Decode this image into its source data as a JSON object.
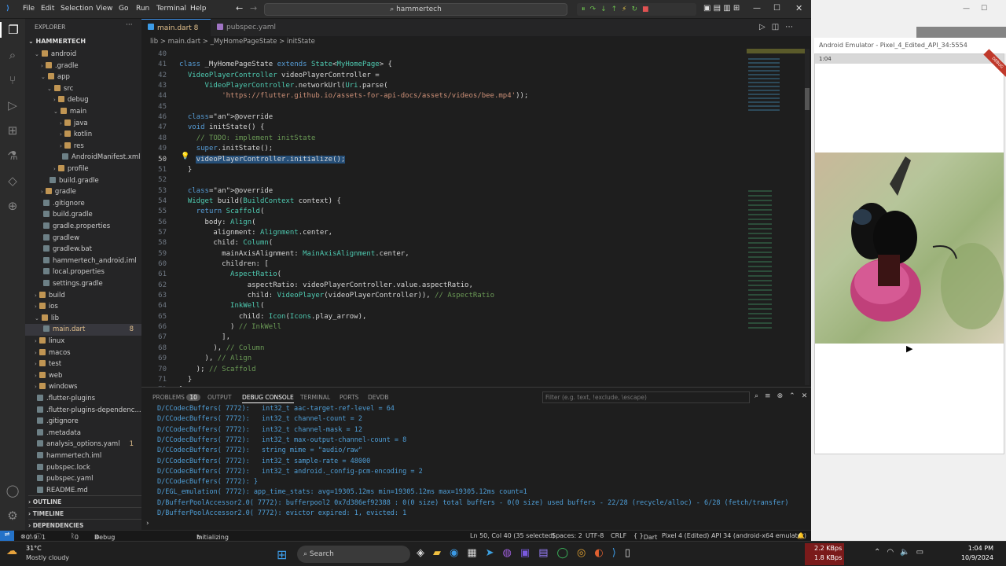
{
  "window": {
    "title": "hammertech",
    "menu": [
      "File",
      "Edit",
      "Selection",
      "View",
      "Go",
      "Run",
      "Terminal",
      "Help"
    ]
  },
  "sidebar": {
    "header": "EXPLORER",
    "project": "HAMMERTECH",
    "items": [
      {
        "label": "android",
        "depth": 1,
        "type": "folder-open"
      },
      {
        "label": ".gradle",
        "depth": 2,
        "type": "folder"
      },
      {
        "label": "app",
        "depth": 2,
        "type": "folder-open"
      },
      {
        "label": "src",
        "depth": 3,
        "type": "folder-open"
      },
      {
        "label": "debug",
        "depth": 4,
        "type": "folder"
      },
      {
        "label": "main",
        "depth": 4,
        "type": "folder-open"
      },
      {
        "label": "java",
        "depth": 5,
        "type": "folder"
      },
      {
        "label": "kotlin",
        "depth": 5,
        "type": "folder"
      },
      {
        "label": "res",
        "depth": 5,
        "type": "folder"
      },
      {
        "label": "AndroidManifest.xml",
        "depth": 5,
        "type": "file"
      },
      {
        "label": "profile",
        "depth": 4,
        "type": "folder"
      },
      {
        "label": "build.gradle",
        "depth": 3,
        "type": "file"
      },
      {
        "label": "gradle",
        "depth": 2,
        "type": "folder"
      },
      {
        "label": ".gitignore",
        "depth": 2,
        "type": "file"
      },
      {
        "label": "build.gradle",
        "depth": 2,
        "type": "file"
      },
      {
        "label": "gradle.properties",
        "depth": 2,
        "type": "file"
      },
      {
        "label": "gradlew",
        "depth": 2,
        "type": "file"
      },
      {
        "label": "gradlew.bat",
        "depth": 2,
        "type": "file"
      },
      {
        "label": "hammertech_android.iml",
        "depth": 2,
        "type": "file"
      },
      {
        "label": "local.properties",
        "depth": 2,
        "type": "file"
      },
      {
        "label": "settings.gradle",
        "depth": 2,
        "type": "file"
      },
      {
        "label": "build",
        "depth": 1,
        "type": "folder"
      },
      {
        "label": "ios",
        "depth": 1,
        "type": "folder"
      },
      {
        "label": "lib",
        "depth": 1,
        "type": "folder-open"
      },
      {
        "label": "main.dart",
        "depth": 2,
        "type": "file",
        "badge": "8"
      },
      {
        "label": "linux",
        "depth": 1,
        "type": "folder"
      },
      {
        "label": "macos",
        "depth": 1,
        "type": "folder"
      },
      {
        "label": "test",
        "depth": 1,
        "type": "folder"
      },
      {
        "label": "web",
        "depth": 1,
        "type": "folder"
      },
      {
        "label": "windows",
        "depth": 1,
        "type": "folder"
      },
      {
        "label": ".flutter-plugins",
        "depth": 1,
        "type": "file"
      },
      {
        "label": ".flutter-plugins-dependenc...",
        "depth": 1,
        "type": "file"
      },
      {
        "label": ".gitignore",
        "depth": 1,
        "type": "file"
      },
      {
        "label": ".metadata",
        "depth": 1,
        "type": "file"
      },
      {
        "label": "analysis_options.yaml",
        "depth": 1,
        "type": "file",
        "badge": "1"
      },
      {
        "label": "hammertech.iml",
        "depth": 1,
        "type": "file"
      },
      {
        "label": "pubspec.lock",
        "depth": 1,
        "type": "file"
      },
      {
        "label": "pubspec.yaml",
        "depth": 1,
        "type": "file"
      },
      {
        "label": "README.md",
        "depth": 1,
        "type": "file"
      }
    ],
    "sections": [
      "OUTLINE",
      "TIMELINE",
      "DEPENDENCIES"
    ]
  },
  "tabs": [
    {
      "label": "main.dart 8",
      "active": true
    },
    {
      "label": "pubspec.yaml",
      "active": false
    }
  ],
  "breadcrumbs": [
    "lib",
    ">",
    "main.dart",
    ">",
    "_MyHomePageState",
    ">",
    "initState"
  ],
  "code": [
    {
      "n": "40",
      "t": ""
    },
    {
      "n": "41",
      "t": "class _MyHomePageState extends State<MyHomePage> {"
    },
    {
      "n": "42",
      "t": "  VideoPlayerController videoPlayerController ="
    },
    {
      "n": "43",
      "t": "      VideoPlayerController.networkUrl(Uri.parse("
    },
    {
      "n": "44",
      "t": "          'https://flutter.github.io/assets-for-api-docs/assets/videos/bee.mp4'));"
    },
    {
      "n": "45",
      "t": ""
    },
    {
      "n": "46",
      "t": "  @override"
    },
    {
      "n": "47",
      "t": "  void initState() {"
    },
    {
      "n": "48",
      "t": "    // TODO: implement initState"
    },
    {
      "n": "49",
      "t": "    super.initState();"
    },
    {
      "n": "50",
      "t": "    videoPlayerController.initialize();"
    },
    {
      "n": "51",
      "t": "  }"
    },
    {
      "n": "52",
      "t": ""
    },
    {
      "n": "53",
      "t": "  @override"
    },
    {
      "n": "54",
      "t": "  Widget build(BuildContext context) {"
    },
    {
      "n": "55",
      "t": "    return Scaffold("
    },
    {
      "n": "56",
      "t": "      body: Align("
    },
    {
      "n": "57",
      "t": "        alignment: Alignment.center,"
    },
    {
      "n": "58",
      "t": "        child: Column("
    },
    {
      "n": "59",
      "t": "          mainAxisAlignment: MainAxisAlignment.center,"
    },
    {
      "n": "60",
      "t": "          children: ["
    },
    {
      "n": "61",
      "t": "            AspectRatio("
    },
    {
      "n": "62",
      "t": "                aspectRatio: videoPlayerController.value.aspectRatio,"
    },
    {
      "n": "63",
      "t": "                child: VideoPlayer(videoPlayerController)), // AspectRatio"
    },
    {
      "n": "64",
      "t": "            InkWell("
    },
    {
      "n": "65",
      "t": "              child: Icon(Icons.play_arrow),"
    },
    {
      "n": "66",
      "t": "            ) // InkWell"
    },
    {
      "n": "67",
      "t": "          ],"
    },
    {
      "n": "68",
      "t": "        ), // Column"
    },
    {
      "n": "69",
      "t": "      ), // Align"
    },
    {
      "n": "70",
      "t": "    ); // Scaffold"
    },
    {
      "n": "71",
      "t": "  }"
    },
    {
      "n": "72",
      "t": "}"
    }
  ],
  "panel": {
    "tabs": [
      "PROBLEMS",
      "OUTPUT",
      "DEBUG CONSOLE",
      "TERMINAL",
      "PORTS",
      "DEVDB"
    ],
    "problems_count": "10",
    "filter_placeholder": "Filter (e.g. text, !exclude, \\escape)",
    "log": [
      "D/CCodecBuffers( 7772):   int32_t aac-target-ref-level = 64",
      "D/CCodecBuffers( 7772):   int32_t channel-count = 2",
      "D/CCodecBuffers( 7772):   int32_t channel-mask = 12",
      "D/CCodecBuffers( 7772):   int32_t max-output-channel-count = 8",
      "D/CCodecBuffers( 7772):   string mime = \"audio/raw\"",
      "D/CCodecBuffers( 7772):   int32_t sample-rate = 48000",
      "D/CCodecBuffers( 7772):   int32_t android._config-pcm-encoding = 2",
      "D/CCodecBuffers( 7772): }",
      "D/EGL_emulation( 7772): app_time_stats: avg=19305.12ms min=19305.12ms max=19305.12ms count=1",
      "D/BufferPoolAccessor2.0( 7772): bufferpool2 0x7d386ef92388 : 0(0 size) total buffers - 0(0 size) used buffers - 22/28 (recycle/alloc) - 6/28 (fetch/transfer)",
      "D/BufferPoolAccessor2.0( 7772): evictor expired: 1, evicted: 1"
    ]
  },
  "status": {
    "errors": "0",
    "warnings": "9",
    "info": "1",
    "ports": "0",
    "debug": "Debug my code + packages",
    "task": "Initializing Gradle Language Server",
    "cursor": "Ln 50, Col 40 (35 selected)",
    "spaces": "Spaces: 2",
    "encoding": "UTF-8",
    "eol": "CRLF",
    "lang": "Dart",
    "device": "Pixel 4 (Edited) API 34 (android-x64 emulator)"
  },
  "emulator": {
    "title": "Android Emulator - Pixel_4_Edited_API_34:5554",
    "time": "1:04",
    "badge": "DEBUG"
  },
  "taskbar": {
    "weather_temp": "31°C",
    "weather_desc": "Mostly cloudy",
    "search": "Search",
    "net_up": "2.2 KBps",
    "net_down": "1.8 KBps",
    "time": "1:04 PM",
    "date": "10/9/2024"
  }
}
